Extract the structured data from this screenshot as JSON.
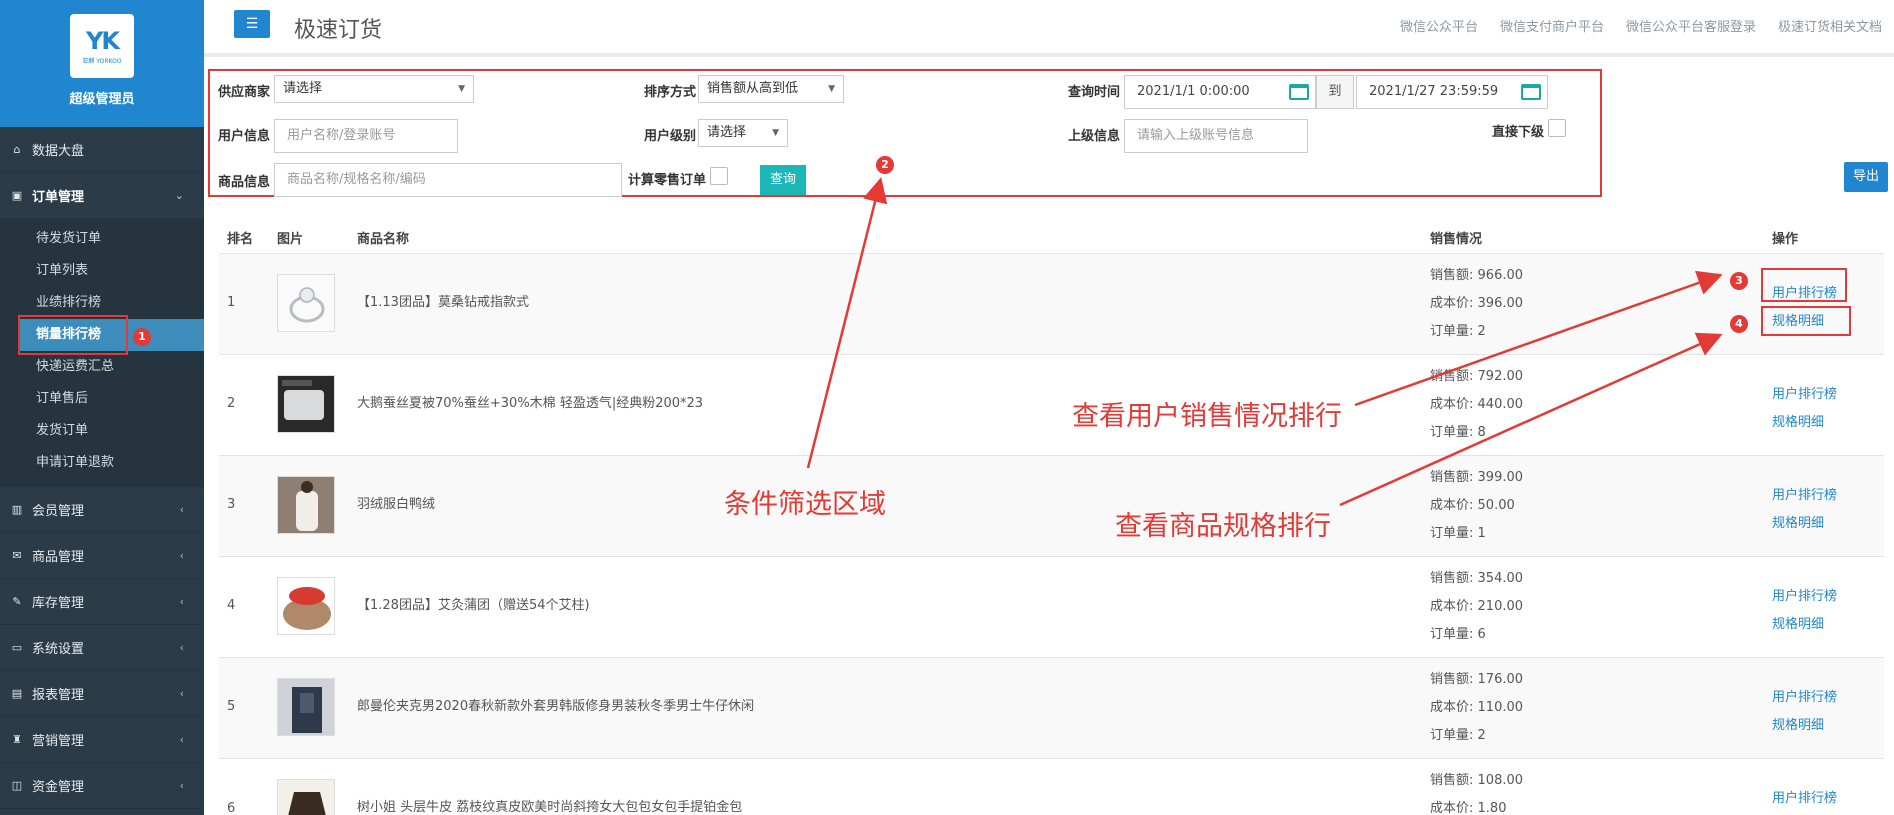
{
  "sidebar": {
    "logo_mark": "YK",
    "logo_sub": "亚麒 YORKOO",
    "role": "超级管理员",
    "items": [
      {
        "label": "数据大盘"
      },
      {
        "label": "订单管理"
      },
      {
        "label": "会员管理"
      },
      {
        "label": "商品管理"
      },
      {
        "label": "库存管理"
      },
      {
        "label": "系统设置"
      },
      {
        "label": "报表管理"
      },
      {
        "label": "营销管理"
      },
      {
        "label": "资金管理"
      }
    ],
    "sub_items": [
      {
        "label": "待发货订单"
      },
      {
        "label": "订单列表"
      },
      {
        "label": "业绩排行榜"
      },
      {
        "label": "销量排行榜"
      },
      {
        "label": "快递运费汇总"
      },
      {
        "label": "订单售后"
      },
      {
        "label": "发货订单"
      },
      {
        "label": "申请订单退款"
      }
    ]
  },
  "header": {
    "title": "极速订货",
    "links": [
      "微信公众平台",
      "微信支付商户平台",
      "微信公众平台客服登录",
      "极速订货相关文档"
    ]
  },
  "filter": {
    "supplier_label": "供应商家",
    "supplier_value": "请选择",
    "sort_label": "排序方式",
    "sort_value": "销售额从高到低",
    "time_label": "查询时间",
    "time_from": "2021/1/1 0:00:00",
    "to_label": "到",
    "time_to": "2021/1/27 23:59:59",
    "user_label": "用户信息",
    "user_placeholder": "用户名称/登录账号",
    "level_label": "用户级别",
    "level_value": "请选择",
    "parent_label": "上级信息",
    "parent_placeholder": "请输入上级账号信息",
    "direct_label": "直接下级",
    "product_label": "商品信息",
    "product_placeholder": "商品名称/规格名称/编码",
    "retail_label": "计算零售订单",
    "query_label": "查询"
  },
  "export_label": "导出",
  "table": {
    "headers": {
      "rank": "排名",
      "image": "图片",
      "name": "商品名称",
      "sales": "销售情况",
      "op": "操作"
    },
    "sales_labels": {
      "amount": "销售额:",
      "cost": "成本价:",
      "orders": "订单量:"
    },
    "op_labels": {
      "user_rank": "用户排行榜",
      "spec_detail": "规格明细"
    },
    "rows": [
      {
        "rank": "1",
        "name": "【1.13团品】莫桑钻戒指款式",
        "amount": "966.00",
        "cost": "396.00",
        "orders": "2"
      },
      {
        "rank": "2",
        "name": "大鹅蚕丝夏被70%蚕丝+30%木棉 轻盈透气|经典粉200*23",
        "amount": "792.00",
        "cost": "440.00",
        "orders": "8"
      },
      {
        "rank": "3",
        "name": "羽绒服白鸭绒",
        "amount": "399.00",
        "cost": "50.00",
        "orders": "1"
      },
      {
        "rank": "4",
        "name": "【1.28团品】艾灸蒲团（赠送54个艾柱)",
        "amount": "354.00",
        "cost": "210.00",
        "orders": "6"
      },
      {
        "rank": "5",
        "name": "郎曼伦夹克男2020春秋新款外套男韩版修身男装秋冬季男士牛仔休闲",
        "amount": "176.00",
        "cost": "110.00",
        "orders": "2"
      },
      {
        "rank": "6",
        "name": "树小姐 头层牛皮 荔枝纹真皮欧美时尚斜挎女大包包女包手提铂金包",
        "amount": "108.00",
        "cost": "1.80",
        "orders": ""
      }
    ]
  },
  "annotations": {
    "n1": "1",
    "n2": "2",
    "n3": "3",
    "n4": "4",
    "filter_area": "条件筛选区域",
    "user_sales": "查看用户销售情况排行",
    "spec_rank": "查看商品规格排行"
  },
  "colors": {
    "accent": "#1f86cf",
    "annotation": "#e53935",
    "sidebar": "#2c3b48"
  }
}
